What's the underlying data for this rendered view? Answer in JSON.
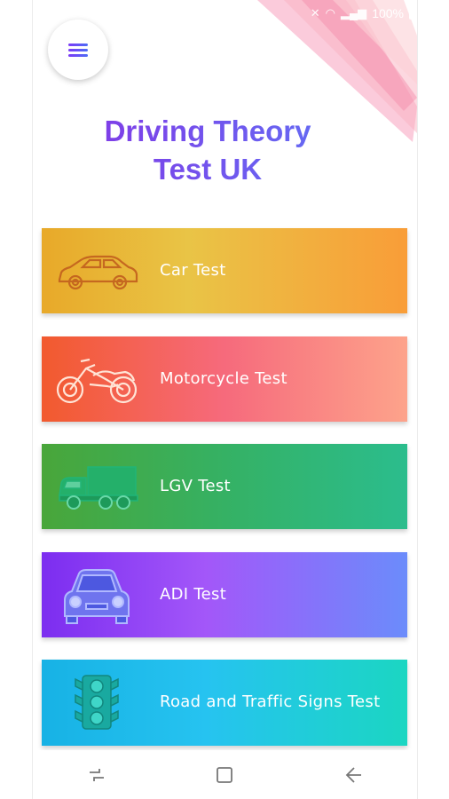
{
  "app": {
    "title_line1": "Driving Theory",
    "title_line2": "Test UK"
  },
  "status_bar": {
    "battery_text": "100%",
    "icons": [
      "mute-icon",
      "wifi-icon",
      "signal-icon",
      "battery-icon"
    ]
  },
  "menu": {
    "icon": "hamburger-menu-icon"
  },
  "cards": [
    {
      "label": "Car Test",
      "icon": "car-icon"
    },
    {
      "label": "Motorcycle Test",
      "icon": "motorcycle-icon"
    },
    {
      "label": "LGV Test",
      "icon": "truck-icon"
    },
    {
      "label": "ADI Test",
      "icon": "car-front-icon"
    },
    {
      "label": "Road and Traffic Signs Test",
      "icon": "traffic-light-icon"
    }
  ],
  "nav": [
    "recent-apps-icon",
    "home-icon",
    "back-icon"
  ],
  "colors": {
    "title_gradient": [
      "#8a2be2",
      "#5a7cf8"
    ],
    "car": [
      "#e8a929",
      "#f99d38"
    ],
    "motorcycle": [
      "#f25a2e",
      "#fda38b"
    ],
    "lgv": [
      "#49a63a",
      "#2bbd8d"
    ],
    "adi": [
      "#7c2df0",
      "#6b8cfb"
    ],
    "signs": [
      "#17b2e5",
      "#1bd6c2"
    ]
  }
}
